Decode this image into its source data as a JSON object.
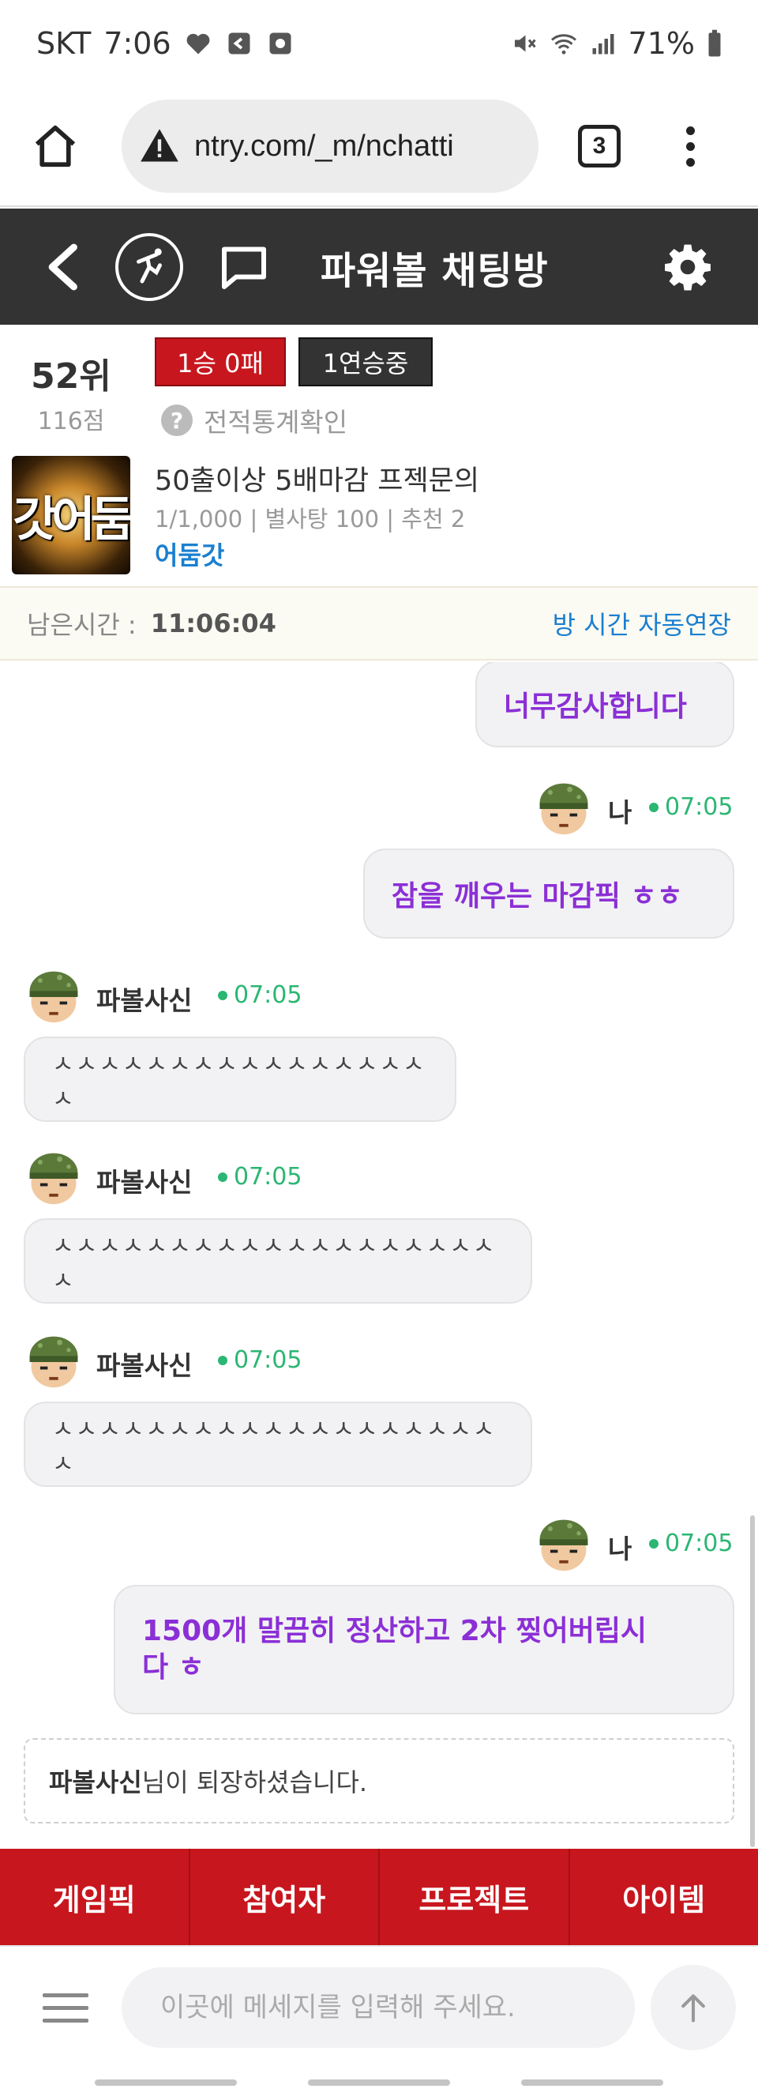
{
  "status_bar": {
    "carrier": "SKT",
    "time": "7:06",
    "battery": "71%"
  },
  "browser": {
    "url": "ntry.com/_m/nchatti",
    "tab_count": "3"
  },
  "header": {
    "title": "파워볼 채팅방"
  },
  "user_stats": {
    "rank": "52위",
    "points": "116점",
    "win_loss": "1승 0패",
    "streak": "1연승중",
    "record_link": "전적통계확인"
  },
  "room": {
    "thumb_text": "갓어둠",
    "title": "50출이상 5배마감 프젝문의",
    "meta": "1/1,000 | 별사탕 100 | 추천 2",
    "owner": "어둠갓"
  },
  "time_bar": {
    "label": "남은시간 :",
    "value": "11:06:04",
    "extend": "방 시간 자동연장"
  },
  "messages": [
    {
      "sender": "",
      "time": "",
      "text": "너무감사합니다",
      "mine": true
    },
    {
      "sender": "나",
      "time": "07:05",
      "text": "잠을 깨우는 마감픽 ㅎㅎ",
      "mine": true
    },
    {
      "sender": "파볼사신",
      "time": "07:05",
      "text": "ㅅㅅㅅㅅㅅㅅㅅㅅㅅㅅㅅㅅㅅㅅㅅㅅㅅ",
      "mine": false
    },
    {
      "sender": "파볼사신",
      "time": "07:05",
      "text": "ㅅㅅㅅㅅㅅㅅㅅㅅㅅㅅㅅㅅㅅㅅㅅㅅㅅㅅㅅㅅ",
      "mine": false
    },
    {
      "sender": "파볼사신",
      "time": "07:05",
      "text": "ㅅㅅㅅㅅㅅㅅㅅㅅㅅㅅㅅㅅㅅㅅㅅㅅㅅㅅㅅㅅ",
      "mine": false
    },
    {
      "sender": "나",
      "time": "07:05",
      "text_line1": "1500개 말끔히 정산하고 2차 찢어버립시",
      "text_line2": "다 ㅎ",
      "mine": true
    }
  ],
  "system_message": {
    "name": "파볼사신",
    "text": "님이 퇴장하셨습니다."
  },
  "tabs": [
    "게임픽",
    "참여자",
    "프로젝트",
    "아이템"
  ],
  "input": {
    "placeholder": "이곳에 메세지를 입력해 주세요."
  },
  "colors": {
    "header_bg": "#333333",
    "accent_red": "#c8161e",
    "my_message": "#8b2fd6",
    "online_green": "#2bb673",
    "link_blue": "#1a7fd0"
  },
  "icons": [
    "home-icon",
    "warning-icon",
    "more-icon",
    "back-icon",
    "powerball-logo-icon",
    "chat-icon",
    "gear-icon",
    "menu-icon",
    "send-arrow-icon"
  ]
}
